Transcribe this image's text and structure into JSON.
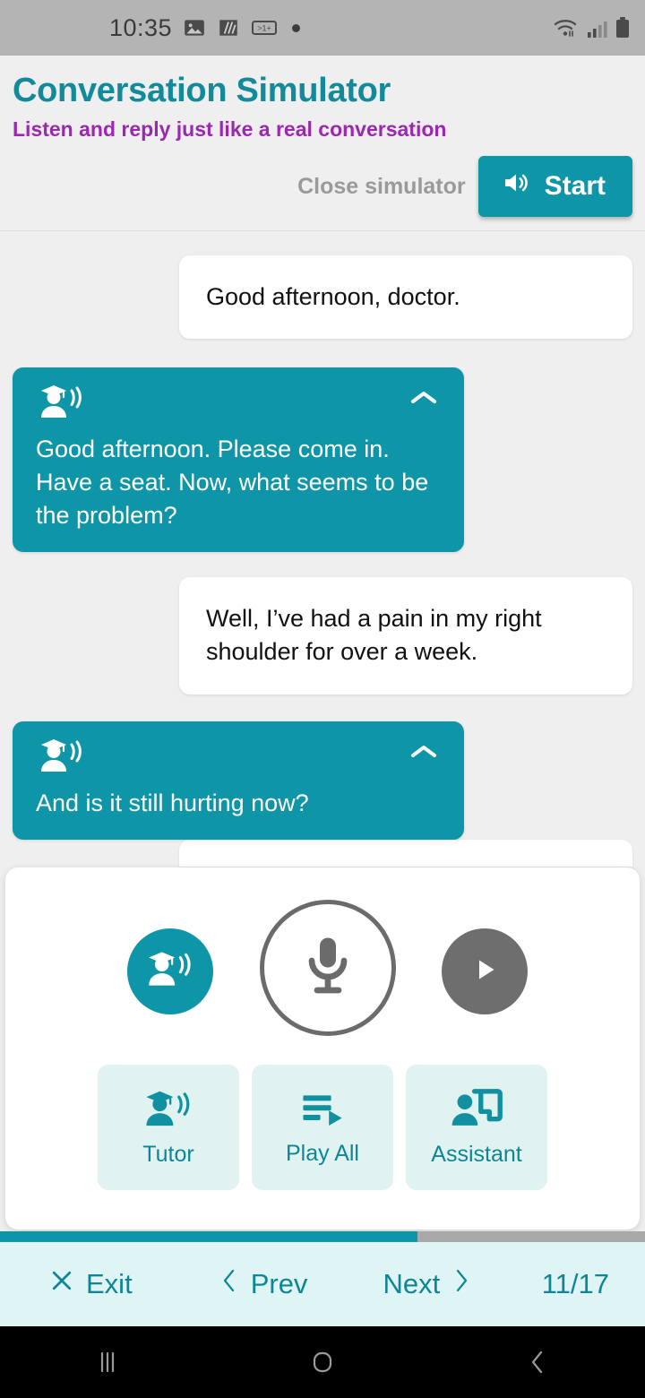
{
  "status_bar": {
    "time": "10:35",
    "icons": [
      "image-icon",
      "slash-icon",
      "notification-count-icon",
      "dot-icon"
    ],
    "right_icons": [
      "wifi-icon",
      "cellular-signal-icon",
      "battery-icon"
    ]
  },
  "header": {
    "title": "Conversation Simulator",
    "subtitle": "Listen and reply just like a real conversation",
    "close_label": "Close simulator",
    "start_label": "Start",
    "start_icon": "speaker-icon"
  },
  "chat": {
    "messages": [
      {
        "role": "user",
        "text": "Good afternoon, doctor."
      },
      {
        "role": "tutor",
        "text": "Good afternoon. Please come in. Have a seat. Now, what seems to be the problem?"
      },
      {
        "role": "user",
        "text": "Well, I’ve had a pain in my right shoulder for over a week."
      },
      {
        "role": "tutor",
        "text": "And is it still hurting now?"
      }
    ],
    "tutor_icon": "tutor-avatar-icon",
    "collapse_icon": "chevron-up-icon"
  },
  "panel": {
    "tutor_round_icon": "tutor-avatar-icon",
    "mic_icon": "microphone-icon",
    "play_icon": "play-icon",
    "actions": [
      {
        "label": "Tutor",
        "icon": "tutor-avatar-icon"
      },
      {
        "label": "Play All",
        "icon": "playlist-play-icon"
      },
      {
        "label": "Assistant",
        "icon": "assistant-board-icon"
      }
    ]
  },
  "progress": {
    "percent": 64.7
  },
  "bottom_nav": {
    "exit_label": "Exit",
    "exit_icon": "close-icon",
    "prev_label": "Prev",
    "prev_icon": "chevron-left-icon",
    "next_label": "Next",
    "next_icon": "chevron-right-icon",
    "counter": "11/17"
  },
  "android_nav": {
    "recents_icon": "recents-icon",
    "home_icon": "home-icon",
    "back_icon": "back-icon"
  },
  "colors": {
    "teal": "#0e96a8",
    "teal_dark": "#0e8695",
    "purple": "#9c27b0",
    "panel_bg": "#ffffff",
    "page_bg": "#efefef",
    "action_bg": "#e0f3f1",
    "nav_bg": "#dff4f4"
  }
}
